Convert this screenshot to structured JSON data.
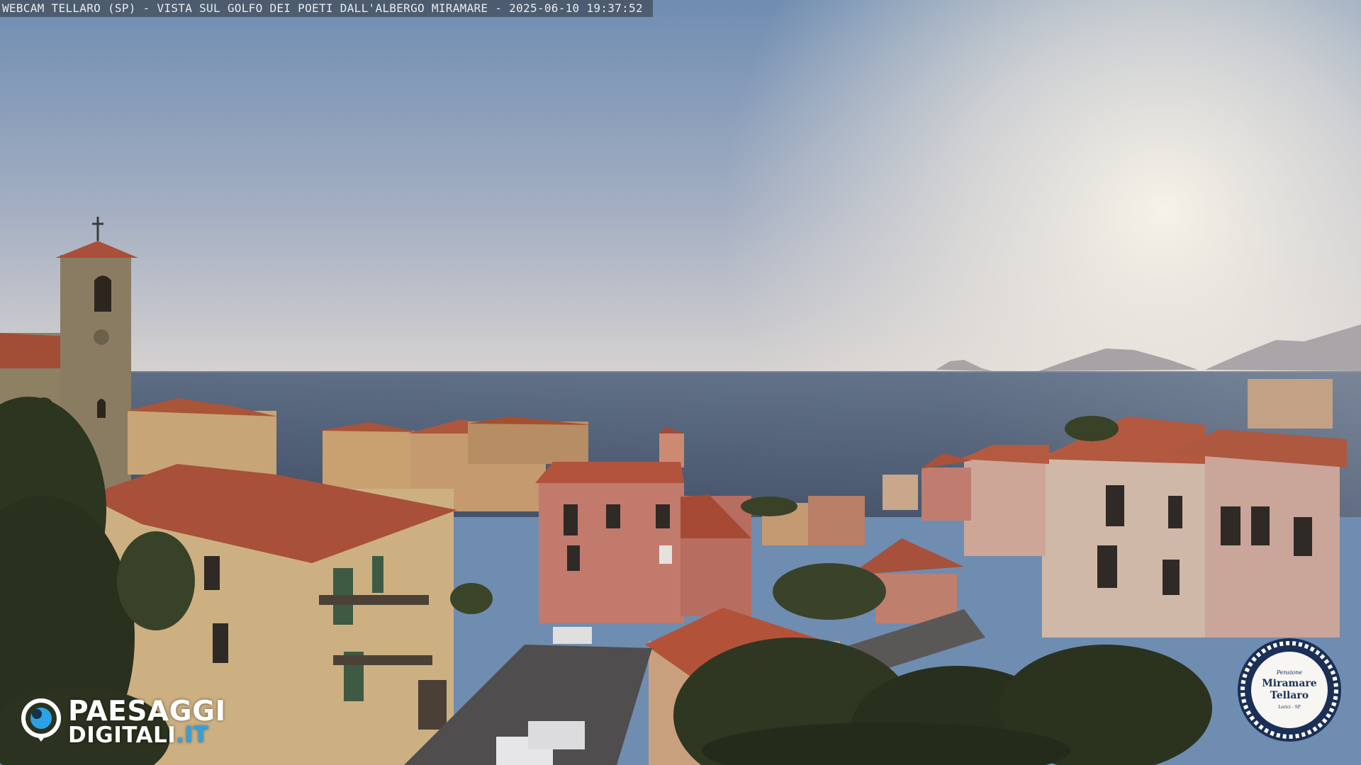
{
  "caption": "WEBCAM TELLARO (SP) - VISTA SUL GOLFO DEI POETI DALL'ALBERGO MIRAMARE - 2025-06-10 19:37:52",
  "watermark_left": {
    "line1": "PAESAGGI",
    "line2": "DIGITALI",
    "line2_suffix": ".IT",
    "icon": "eye-logo-icon"
  },
  "watermark_right": {
    "top_text": "Pensione",
    "name_line1": "Miramare",
    "name_line2": "Tellaro",
    "small_text": "Lerici - SP",
    "icon": "rope-seal-icon"
  },
  "colors": {
    "sky_top": "#6f8db0",
    "sky_horizon": "#d9d4cf",
    "sun_glow": "#f3efe6",
    "sea": "#4a5b72",
    "roof": "#b0553a",
    "logo_accent": "#2aa3e6",
    "seal_navy": "#1b2f57"
  }
}
